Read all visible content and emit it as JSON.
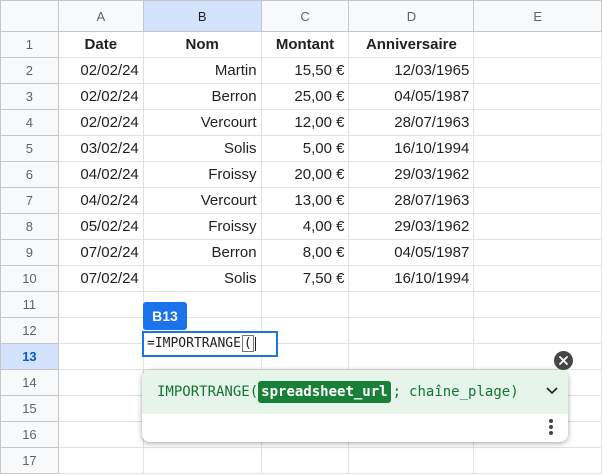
{
  "columns": [
    "A",
    "B",
    "C",
    "D",
    "E"
  ],
  "rows": [
    {
      "num": "1",
      "cells": [
        "Date",
        "Nom",
        "Montant",
        "Anniversaire",
        ""
      ]
    },
    {
      "num": "2",
      "cells": [
        "02/02/24",
        "Martin",
        "15,50 €",
        "12/03/1965",
        ""
      ]
    },
    {
      "num": "3",
      "cells": [
        "02/02/24",
        "Berron",
        "25,00 €",
        "04/05/1987",
        ""
      ]
    },
    {
      "num": "4",
      "cells": [
        "02/02/24",
        "Vercourt",
        "12,00 €",
        "28/07/1963",
        ""
      ]
    },
    {
      "num": "5",
      "cells": [
        "03/02/24",
        "Solis",
        "5,00 €",
        "16/10/1994",
        ""
      ]
    },
    {
      "num": "6",
      "cells": [
        "04/02/24",
        "Froissy",
        "20,00 €",
        "29/03/1962",
        ""
      ]
    },
    {
      "num": "7",
      "cells": [
        "04/02/24",
        "Vercourt",
        "13,00 €",
        "28/07/1963",
        ""
      ]
    },
    {
      "num": "8",
      "cells": [
        "05/02/24",
        "Froissy",
        "4,00 €",
        "29/03/1962",
        ""
      ]
    },
    {
      "num": "9",
      "cells": [
        "07/02/24",
        "Berron",
        "8,00 €",
        "04/05/1987",
        ""
      ]
    },
    {
      "num": "10",
      "cells": [
        "07/02/24",
        "Solis",
        "7,50 €",
        "16/10/1994",
        ""
      ]
    },
    {
      "num": "11",
      "cells": [
        "",
        "",
        "",
        "",
        ""
      ]
    },
    {
      "num": "12",
      "cells": [
        "",
        "",
        "",
        "",
        ""
      ]
    },
    {
      "num": "13",
      "cells": [
        "",
        "",
        "",
        "",
        ""
      ]
    },
    {
      "num": "14",
      "cells": [
        "",
        "",
        "",
        "",
        ""
      ]
    },
    {
      "num": "15",
      "cells": [
        "",
        "",
        "",
        "",
        ""
      ]
    },
    {
      "num": "16",
      "cells": [
        "",
        "",
        "",
        "",
        ""
      ]
    },
    {
      "num": "17",
      "cells": [
        "",
        "",
        "",
        "",
        ""
      ]
    }
  ],
  "active_cell": {
    "ref": "B13",
    "formula_text": "=IMPORTRANGE",
    "open_paren": "("
  },
  "formula_help": {
    "function": "IMPORTRANGE(",
    "arg1": "spreadsheet_url",
    "separator": ";",
    "arg2": "chaîne_plage",
    "close": ")",
    "expand_icon": "chevron-down-icon",
    "more_icon": "more-vert-icon",
    "close_icon": "close-icon"
  },
  "colors": {
    "selection": "#d3e3fd",
    "accent": "#1a73e8",
    "formula_green": "#137333",
    "highlight_bg": "#188038"
  }
}
